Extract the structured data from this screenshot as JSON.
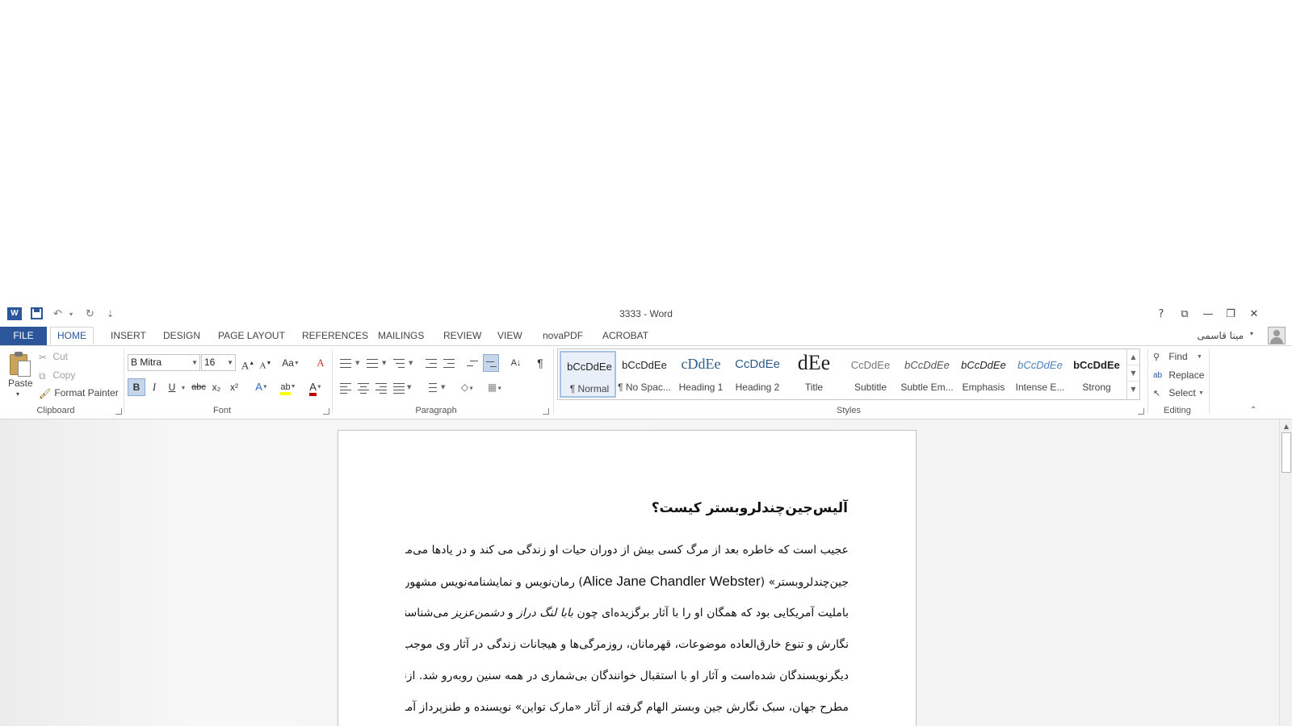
{
  "window": {
    "title": "3333 - Word",
    "help": "?",
    "ribbon_display": "⧉",
    "minimize": "—",
    "restore": "❐",
    "close": "✕"
  },
  "qat": {
    "app_icon": "W",
    "undo": "↶",
    "redo": "↻",
    "customize": "⇣",
    "dropdown": "▾"
  },
  "tabs": [
    {
      "label": "FILE"
    },
    {
      "label": "HOME"
    },
    {
      "label": "INSERT"
    },
    {
      "label": "DESIGN"
    },
    {
      "label": "PAGE LAYOUT"
    },
    {
      "label": "REFERENCES"
    },
    {
      "label": "MAILINGS"
    },
    {
      "label": "REVIEW"
    },
    {
      "label": "VIEW"
    },
    {
      "label": "novaPDF"
    },
    {
      "label": "ACROBAT"
    }
  ],
  "user": {
    "name": "مینا قاسمی",
    "dropdown": "▾"
  },
  "clipboard": {
    "group_label": "Clipboard",
    "paste": "Paste",
    "paste_dd": "▾",
    "cut": "Cut",
    "copy": "Copy",
    "format_painter": "Format Painter"
  },
  "font": {
    "group_label": "Font",
    "font_name": "B Mitra",
    "font_size": "16",
    "grow": "A",
    "shrink": "A",
    "change_case": "Aa",
    "clear": "A",
    "bold": "B",
    "italic": "I",
    "underline": "U",
    "strike": "abc",
    "subscript": "x₂",
    "superscript": "x²",
    "effects": "A",
    "highlight": "ab",
    "font_color": "A"
  },
  "paragraph": {
    "group_label": "Paragraph",
    "sort": "A↓",
    "pilcrow": "¶"
  },
  "styles": {
    "group_label": "Styles",
    "items": [
      {
        "preview": "bCcDdEe",
        "name": "¶ Normal"
      },
      {
        "preview": "bCcDdEe",
        "name": "¶ No Spac..."
      },
      {
        "preview": "cDdEe",
        "name": "Heading 1"
      },
      {
        "preview": "CcDdEe",
        "name": "Heading 2"
      },
      {
        "preview": "dEe",
        "name": "Title"
      },
      {
        "preview": "CcDdEe",
        "name": "Subtitle"
      },
      {
        "preview": "bCcDdEe",
        "name": "Subtle Em..."
      },
      {
        "preview": "bCcDdEe",
        "name": "Emphasis"
      },
      {
        "preview": "bCcDdEe",
        "name": "Intense E..."
      },
      {
        "preview": "bCcDdEe",
        "name": "Strong"
      }
    ]
  },
  "editing": {
    "group_label": "Editing",
    "find": "Find",
    "replace": "Replace",
    "select": "Select"
  },
  "document": {
    "heading": "آلیس‌جین‌چندلروبستر کیست؟",
    "line1": "عجیب است که خاطره بعد از مرگ کسی بیش از دوران حیات او زندگی می کند و در یادها می‌ماند. «آلیس",
    "line2_pre": "جین‌چندلروبستر» (",
    "line2_latin": "Alice Jane Chandler Webster",
    "line2_post": ") رمان‌نویس و نمایشنامه‌نویس مشهور",
    "line3_pre": "بامليت آمریکایی بود که همگان او را با آثار برگزیده‌ای چون ",
    "line3_em1": "بابا لنگ دراز",
    "line3_mid": " و ",
    "line3_em2": "دشمن‌عزیز",
    "line3_post": " می‌شناسند. شیوه",
    "line4": "نگارش و تنوع خارق‌العاده موضوعات، قهرمانان، روزمرگی‌ها و هیجانات زندگی در آثار وی موجب تمایز او با",
    "line5": "دیگرنویسندگان شده‌است و آثار او با استقبال خوانندگان بی‌شماری در همه سنین روبه‌رو شد. ازنگاه نویسندگان",
    "line6": "مطرح جهان، سبک نگارش جین وبستر الهام گرفته از آثار «مارک تواین» نویسنده و طنزپرداز آمریکایی و خالق"
  },
  "colors": {
    "accent": "#2b579a",
    "highlight": "#ffff00",
    "font_color": "#c00000"
  }
}
